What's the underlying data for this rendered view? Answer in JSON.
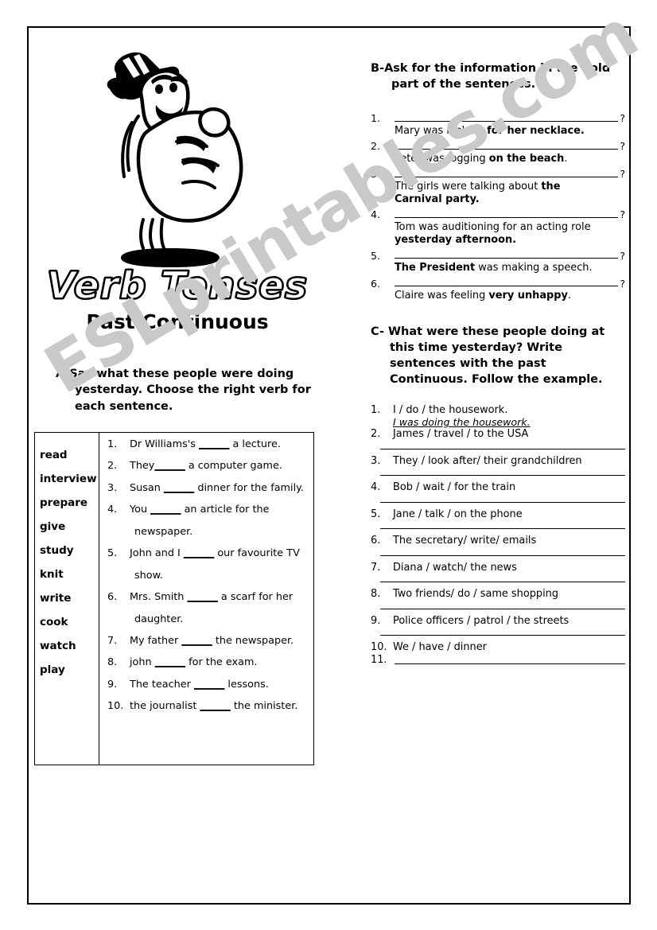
{
  "worksheet": {
    "title_main": "Verb Tenses",
    "title_sub": "Past Continuous",
    "mascot_icon": "thumbs-up-character-icon",
    "watermark": "ESLprintables.com"
  },
  "exercise_a": {
    "instruction_line1": "A-Say what these people were doing",
    "instruction_line2": "yesterday. Choose the right verb for",
    "instruction_line3": "each sentence.",
    "verbs": [
      "read",
      "interview",
      "prepare",
      "give",
      "study",
      "knit",
      "write",
      "cook",
      "watch",
      "play"
    ],
    "sentences": [
      {
        "num": "1.",
        "before": "Dr Williams's ",
        "blank": "______",
        "after": " a lecture.",
        "cont": ""
      },
      {
        "num": "2.",
        "before": "They",
        "blank": "______",
        "after": " a computer game.",
        "cont": ""
      },
      {
        "num": "3.",
        "before": "Susan ",
        "blank": "______",
        "after": " dinner for the family.",
        "cont": ""
      },
      {
        "num": "4.",
        "before": "You ",
        "blank": "______",
        "after": " an article for the",
        "cont": "newspaper."
      },
      {
        "num": "5.",
        "before": "John and I ",
        "blank": "______",
        "after": " our favourite TV",
        "cont": "show."
      },
      {
        "num": "6.",
        "before": "Mrs. Smith ",
        "blank": "______",
        "after": " a scarf for her",
        "cont": "daughter."
      },
      {
        "num": "7.",
        "before": "My father ",
        "blank": "______",
        "after": " the newspaper.",
        "cont": ""
      },
      {
        "num": "8.",
        "before": "john ",
        "blank": "______",
        "after": " for the exam.",
        "cont": ""
      },
      {
        "num": "9.",
        "before": "The teacher ",
        "blank": "______",
        "after": " lessons.",
        "cont": ""
      },
      {
        "num": "10.",
        "before": "the journalist ",
        "blank": "______",
        "after": " the minister.",
        "cont": ""
      }
    ]
  },
  "exercise_b": {
    "instruction_line1": "B-Ask for the information in the bold",
    "instruction_line2": "part of the sentences.",
    "question_mark": "?",
    "items": [
      {
        "num": "1.",
        "plain1": "Mary was looking ",
        "bold": "for her necklace.",
        "plain2": "",
        "wrap": ""
      },
      {
        "num": "2.",
        "plain1": "Peter was jogging ",
        "bold": "on the beach",
        "plain2": ".",
        "wrap": ""
      },
      {
        "num": "3.",
        "plain1": "The girls were talking about ",
        "bold": "the",
        "plain2": "",
        "wrap": "Carnival party."
      },
      {
        "num": "4.",
        "plain1": "Tom was auditioning for an acting role",
        "bold": "",
        "plain2": "",
        "wrap": "yesterday afternoon."
      },
      {
        "num": "5.",
        "plain1": "",
        "bold": "The President",
        "plain2": " was making a speech.",
        "wrap": ""
      },
      {
        "num": "6.",
        "plain1": "Claire was feeling ",
        "bold": "very unhappy",
        "plain2": ".",
        "wrap": ""
      }
    ]
  },
  "exercise_c": {
    "instruction_line1": "C- What were these people doing at this",
    "instruction_line2": "time yesterday? Write sentences with",
    "instruction_line3": "the past Continuous. Follow the",
    "instruction_line4": "example.",
    "items": [
      {
        "num": "1.",
        "text": "I / do / the housework.",
        "example": "I was doing the housework.",
        "rule": false
      },
      {
        "num": "2.",
        "text": "James / travel / to the USA",
        "example": "",
        "rule": true
      },
      {
        "num": "3.",
        "text": "They / look after/ their grandchildren",
        "example": "",
        "rule": true
      },
      {
        "num": "4.",
        "text": "Bob / wait / for the train",
        "example": "",
        "rule": true
      },
      {
        "num": "5.",
        "text": "Jane / talk / on the phone",
        "example": "",
        "rule": true
      },
      {
        "num": "6.",
        "text": "The secretary/ write/ emails",
        "example": "",
        "rule": true
      },
      {
        "num": "7.",
        "text": "Diana / watch/ the news",
        "example": "",
        "rule": true
      },
      {
        "num": "8.",
        "text": "Two friends/ do / same shopping",
        "example": "",
        "rule": true
      },
      {
        "num": "9.",
        "text": "Police officers / patrol / the streets",
        "example": "",
        "rule": true
      },
      {
        "num": "10.",
        "text": "We / have / dinner",
        "example": "",
        "rule": false
      },
      {
        "num": "11.",
        "text": "",
        "example": "",
        "rule": false
      }
    ]
  }
}
